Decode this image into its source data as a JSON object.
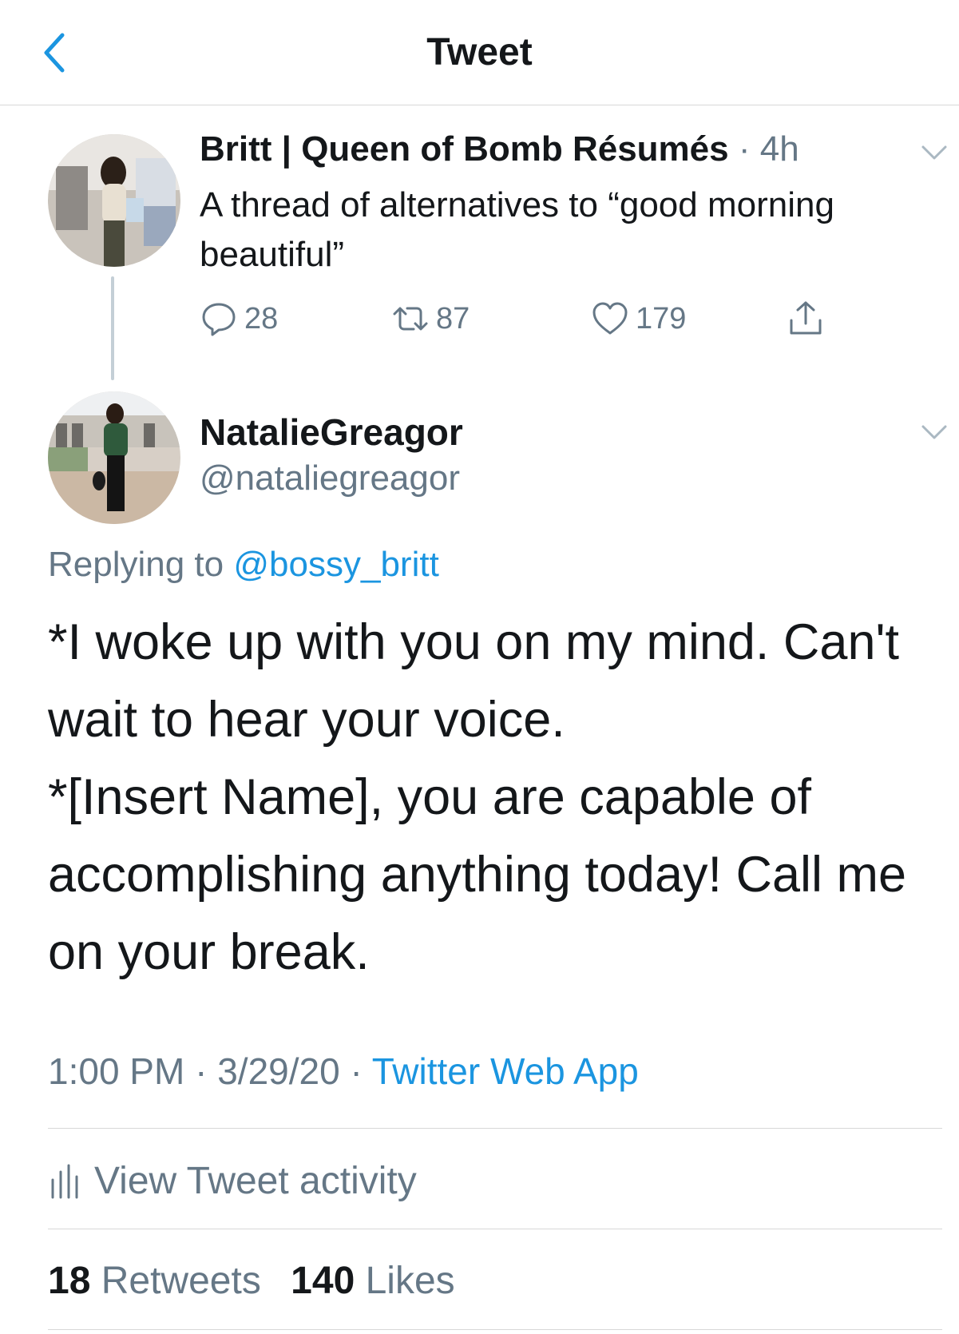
{
  "header": {
    "title": "Tweet",
    "back_icon": "chevron-left-icon"
  },
  "parent_tweet": {
    "author_name": "Britt | Queen of Bomb Résumés",
    "separator": "·",
    "time": "4h",
    "text": "A thread of alternatives to “good morning beautiful”",
    "reply_count": "28",
    "retweet_count": "87",
    "like_count": "179"
  },
  "main_tweet": {
    "author_name": "NatalieGreagor",
    "handle": "@nataliegreagor",
    "replying_prefix": "Replying to",
    "replying_to": "@bossy_britt",
    "lines": [
      "*I woke up with you on my mind. Can't wait to hear your voice.",
      "*[Insert Name], you are capable of accomplishing anything today! Call me on your break."
    ],
    "time": "1:00 PM",
    "date": "3/29/20",
    "separator": "·",
    "source": "Twitter Web App",
    "activity_label": "View Tweet activity",
    "retweets_count": "18",
    "retweets_label": "Retweets",
    "likes_count": "140",
    "likes_label": "Likes"
  },
  "colors": {
    "accent": "#1b95e0",
    "text": "#14171a",
    "secondary": "#657786"
  }
}
